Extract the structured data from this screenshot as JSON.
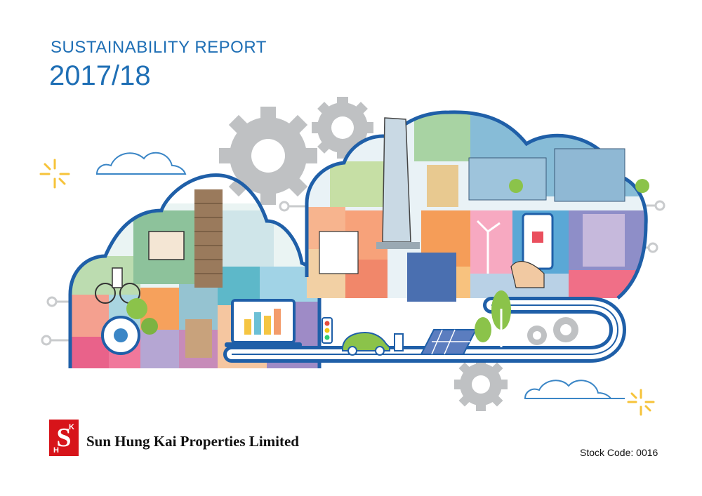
{
  "report": {
    "title": "SUSTAINABILITY REPORT",
    "year": "2017/18"
  },
  "company": {
    "name": "Sun Hung Kai Properties Limited",
    "logo_letters": [
      "S",
      "K",
      "H"
    ],
    "brand_color": "#d7141a"
  },
  "stock_code": "Stock Code: 0016",
  "colors": {
    "title_blue": "#1f6fb5",
    "outline_blue": "#1f5fa8",
    "gear_gray": "#bfc1c3",
    "sun_yellow": "#f6c33a"
  }
}
